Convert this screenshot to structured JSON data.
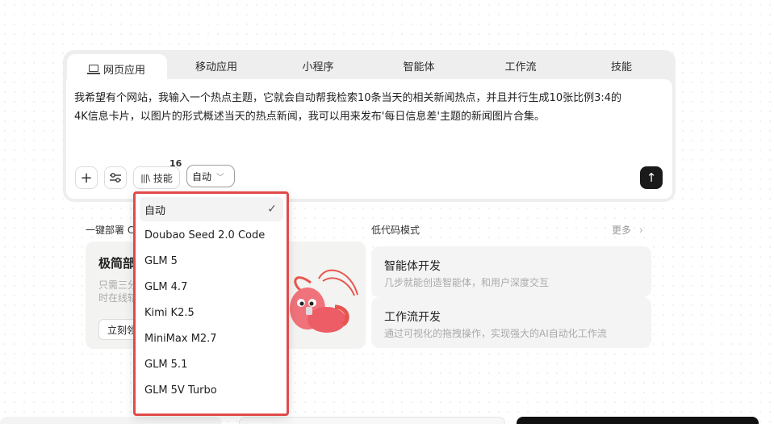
{
  "tabs": [
    {
      "label": "网页应用"
    },
    {
      "label": "移动应用"
    },
    {
      "label": "小程序"
    },
    {
      "label": "智能体"
    },
    {
      "label": "工作流"
    },
    {
      "label": "技能"
    }
  ],
  "editor": {
    "prompt_line1": "我希望有个网站，我输入一个热点主题，它就会自动帮我检索10条当天的相关新闻热点，并且并行生成10张比例3:4的",
    "prompt_line2": "4K信息卡片，以图片的形式概述当天的热点新闻，我可以用来发布'每日信息差'主题的新闻图片合集。",
    "plus_label": "+",
    "skill_label": "技能",
    "skill_count": "16",
    "model_selected": "自动",
    "send_label": "↑"
  },
  "dropdown": {
    "options": [
      {
        "label": "自动",
        "selected": true
      },
      {
        "label": "Doubao Seed 2.0 Code"
      },
      {
        "label": "GLM 5"
      },
      {
        "label": "GLM 4.7"
      },
      {
        "label": "Kimi K2.5"
      },
      {
        "label": "MiniMax M2.7"
      },
      {
        "label": "GLM 5.1"
      },
      {
        "label": "GLM 5V Turbo"
      }
    ],
    "check_icon": "✓"
  },
  "sections": {
    "deploy_label": "一键部署 C",
    "lowcode_label": "低代码模式",
    "more_label": "更多",
    "more_arrow": "›"
  },
  "deploy_card": {
    "title": "极简部",
    "desc1": "只需三分",
    "desc2": "时在线辖",
    "button": "立刻领"
  },
  "features": [
    {
      "title": "智能体开发",
      "desc": "几步就能创造智能体，和用户深度交互"
    },
    {
      "title": "工作流开发",
      "desc": "通过可视化的拖拽操作，实现强大的AI自动化工作流"
    }
  ],
  "colors": {
    "highlight_border": "#e14a4a",
    "send_button": "#1a1a1a",
    "mascot_red": "#e8554e"
  }
}
